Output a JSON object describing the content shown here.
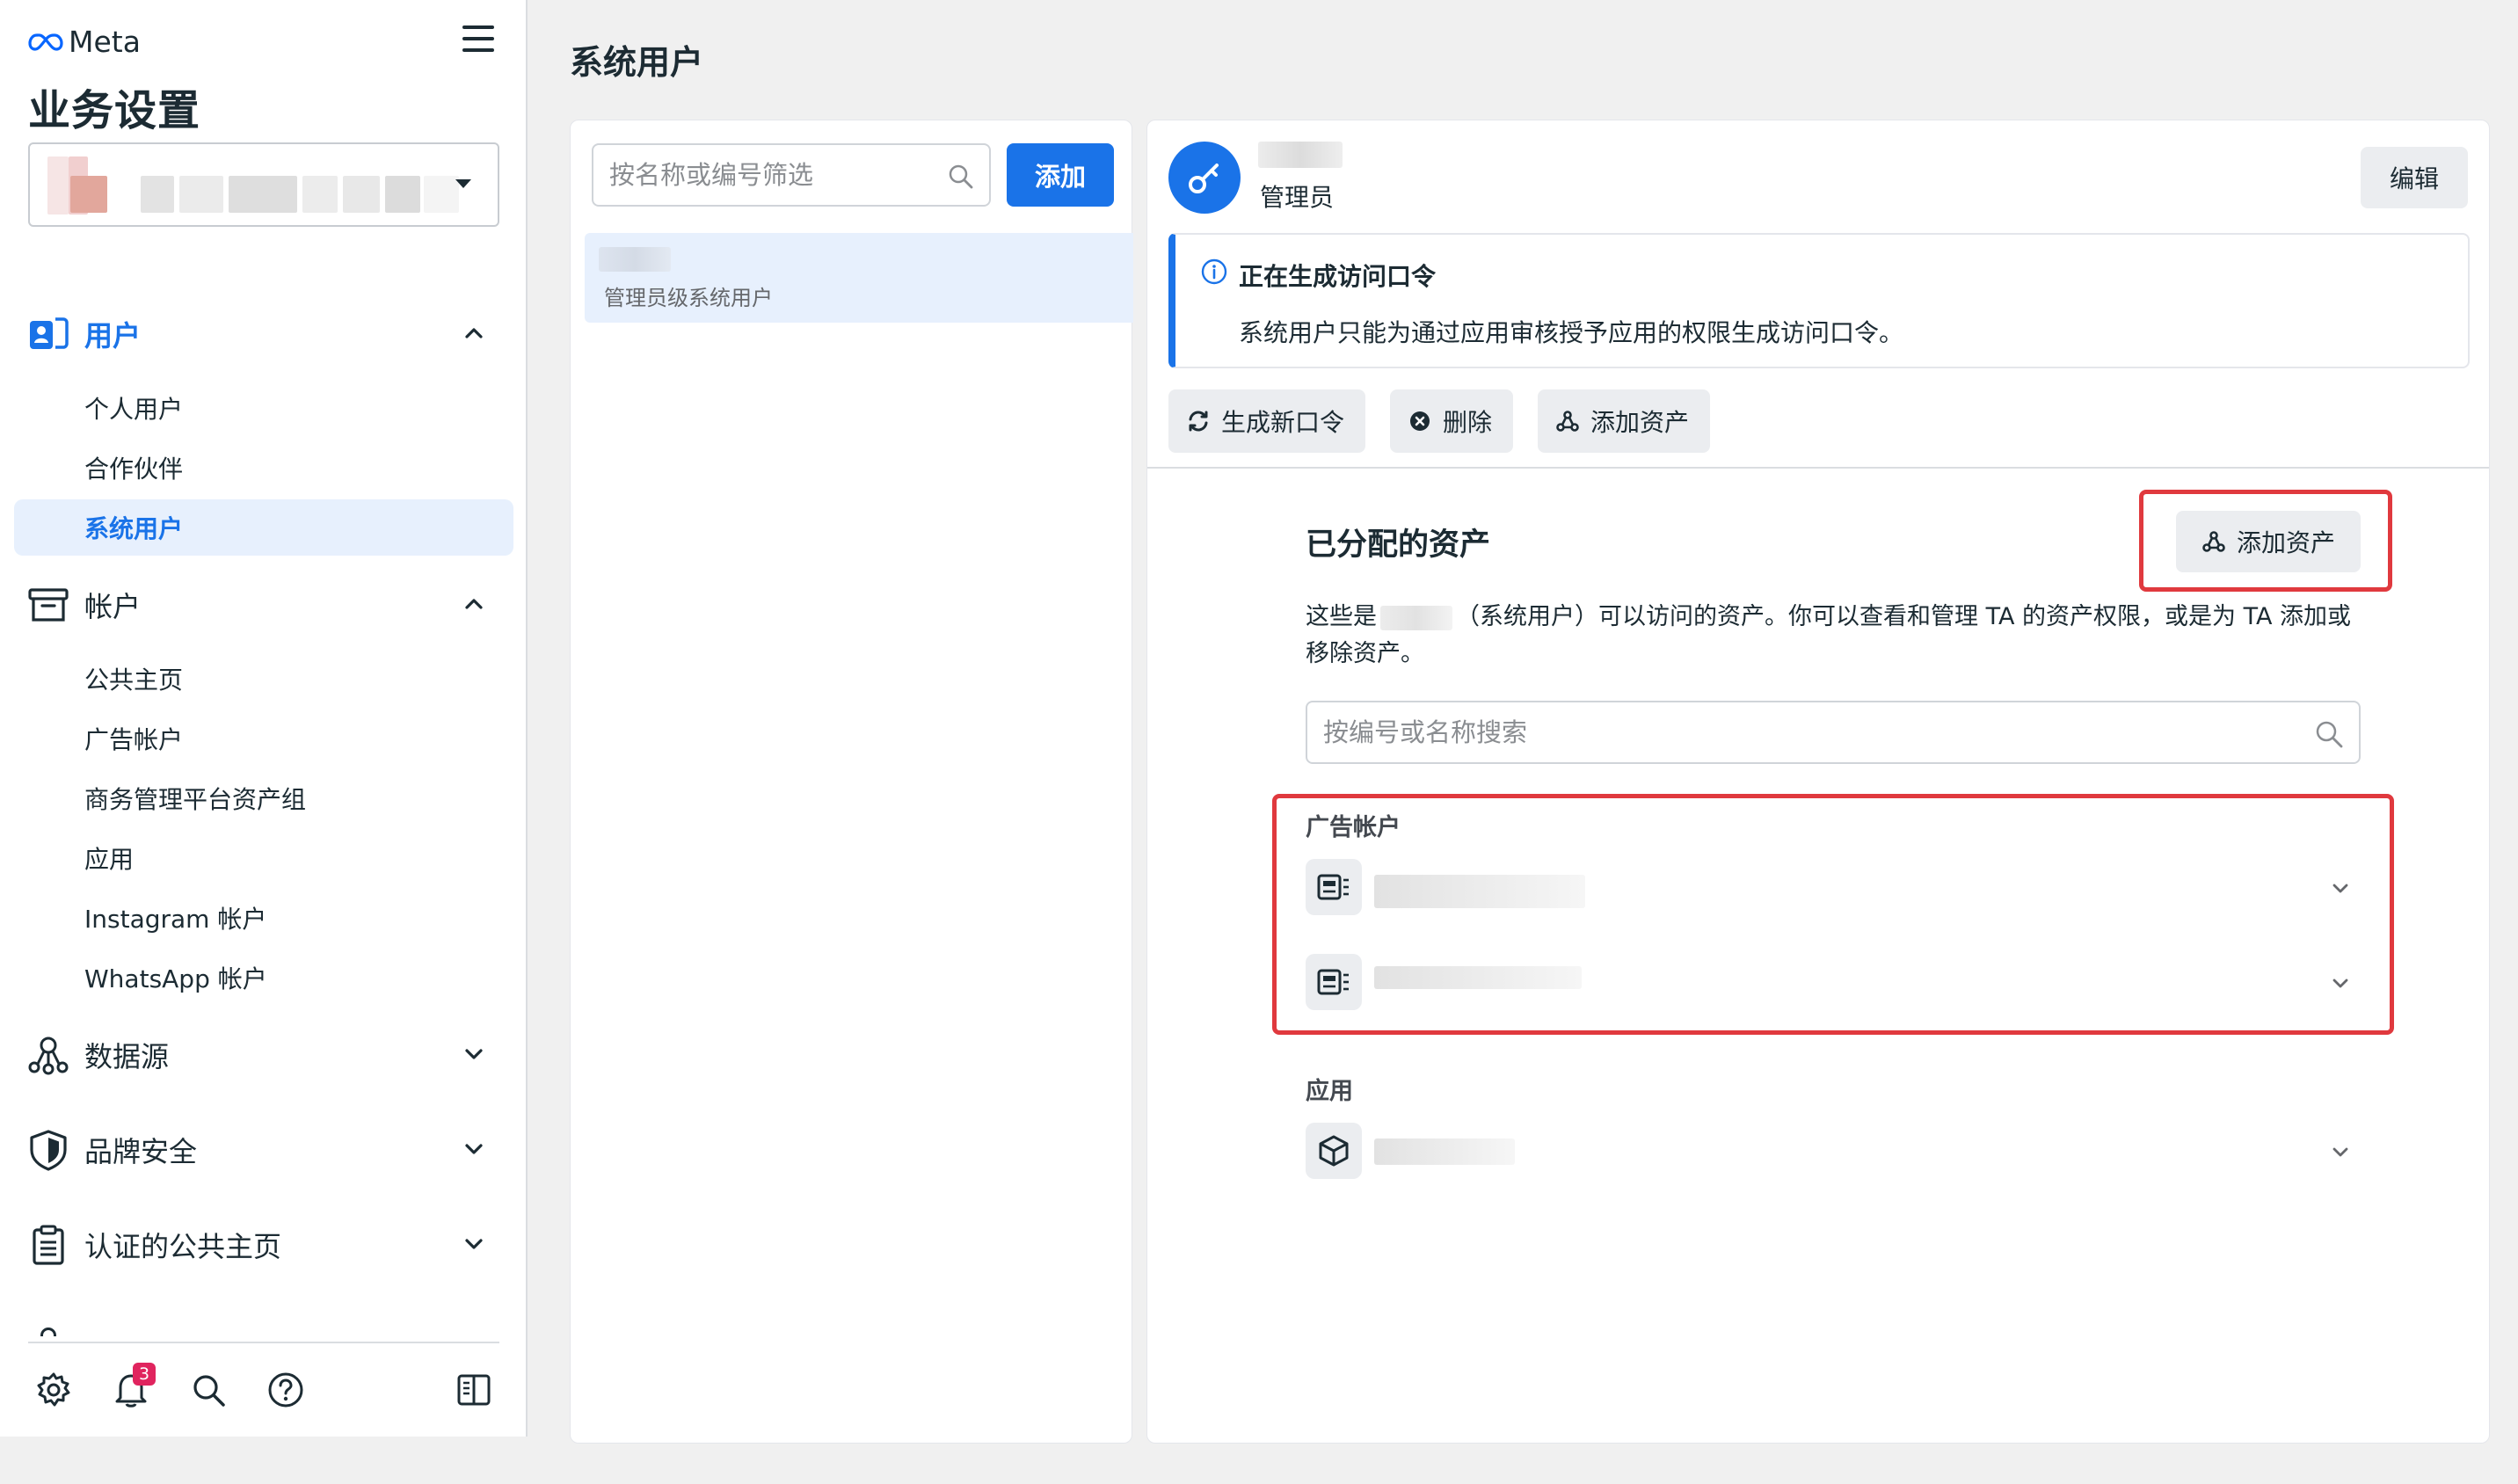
{
  "brand": {
    "logo_text": "Meta",
    "accent": "#1a73e8",
    "highlight": "#e0393e"
  },
  "sidebar": {
    "title": "业务设置",
    "sections": [
      {
        "label": "用户",
        "icon": "users-icon",
        "expanded": true,
        "active": true,
        "items": [
          {
            "label": "个人用户"
          },
          {
            "label": "合作伙伴"
          },
          {
            "label": "系统用户",
            "active": true
          }
        ]
      },
      {
        "label": "帐户",
        "icon": "archive-icon",
        "expanded": true,
        "items": [
          {
            "label": "公共主页"
          },
          {
            "label": "广告帐户"
          },
          {
            "label": "商务管理平台资产组"
          },
          {
            "label": "应用"
          },
          {
            "label": "Instagram 帐户"
          },
          {
            "label": "WhatsApp 帐户"
          }
        ]
      },
      {
        "label": "数据源",
        "icon": "data-sources-icon",
        "expanded": false
      },
      {
        "label": "品牌安全",
        "icon": "shield-icon",
        "expanded": false
      },
      {
        "label": "认证的公共主页",
        "icon": "clipboard-icon",
        "expanded": false
      }
    ],
    "bottom": {
      "notification_count": "3"
    }
  },
  "header": {
    "title": "系统用户"
  },
  "list": {
    "search_placeholder": "按名称或编号筛选",
    "add_label": "添加",
    "rows": [
      {
        "subtitle": "管理员级系统用户"
      }
    ]
  },
  "detail": {
    "role": "管理员",
    "edit_label": "编辑",
    "info": {
      "title": "正在生成访问口令",
      "desc": "系统用户只能为通过应用审核授予应用的权限生成访问口令。"
    },
    "actions": {
      "regenerate": "生成新口令",
      "delete": "删除",
      "add_assets": "添加资产"
    },
    "assets": {
      "title": "已分配的资产",
      "add_label": "添加资产",
      "desc_prefix": "这些是",
      "desc_rest": "（系统用户）可以访问的资产。你可以查看和管理 TA 的资产权限，或是为 TA 添加或移除资产。",
      "search_placeholder": "按编号或名称搜索",
      "groups": [
        {
          "label": "广告帐户",
          "items": 2
        },
        {
          "label": "应用",
          "items": 1
        }
      ]
    }
  }
}
